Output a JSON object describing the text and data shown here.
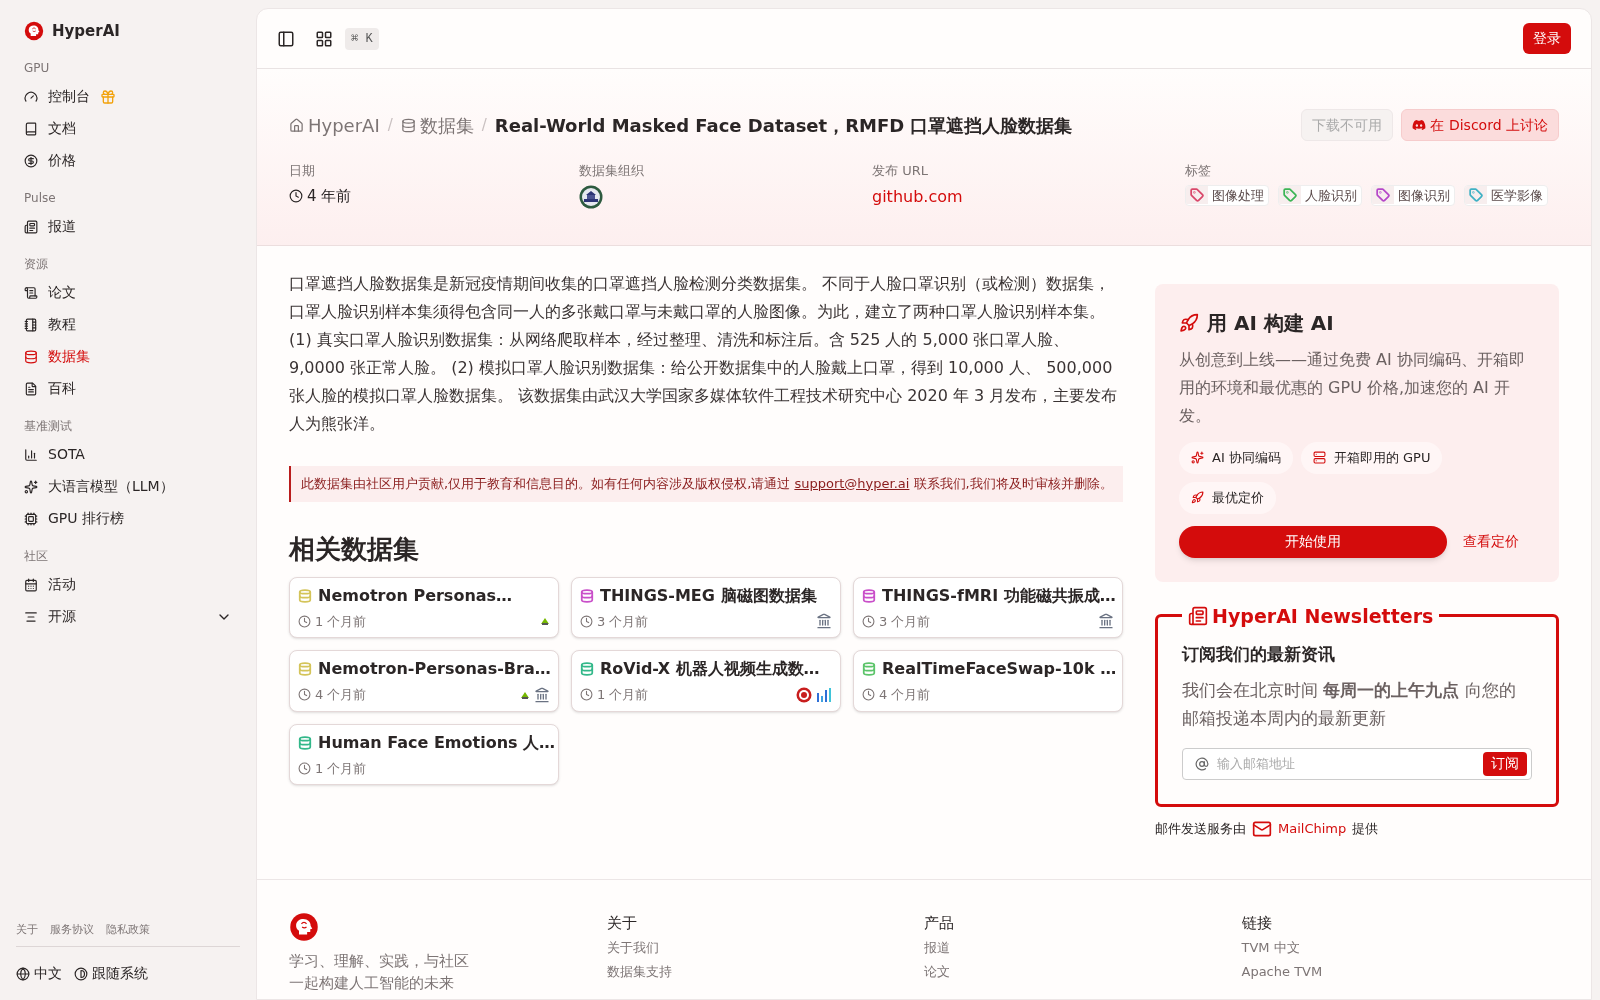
{
  "brand": {
    "name": "HyperAI"
  },
  "sidebar": {
    "groups": [
      {
        "label": "GPU",
        "items": [
          {
            "label": "控制台",
            "selected": false,
            "gift": true
          },
          {
            "label": "文档",
            "selected": false
          },
          {
            "label": "价格",
            "selected": false
          }
        ]
      },
      {
        "label": "Pulse",
        "items": [
          {
            "label": "报道",
            "selected": false
          }
        ]
      },
      {
        "label": "资源",
        "items": [
          {
            "label": "论文",
            "selected": false
          },
          {
            "label": "教程",
            "selected": false
          },
          {
            "label": "数据集",
            "selected": true
          },
          {
            "label": "百科",
            "selected": false
          }
        ]
      },
      {
        "label": "基准测试",
        "items": [
          {
            "label": "SOTA",
            "selected": false
          },
          {
            "label": "大语言模型（LLM）",
            "selected": false
          },
          {
            "label": "GPU 排行榜",
            "selected": false
          }
        ]
      },
      {
        "label": "社区",
        "items": [
          {
            "label": "活动",
            "selected": false
          },
          {
            "label": "开源",
            "selected": false,
            "expandable": true
          }
        ]
      }
    ],
    "footer_links": [
      "关于",
      "服务协议",
      "隐私政策"
    ],
    "language": "中文",
    "theme": "跟随系统"
  },
  "topbar": {
    "shortcut": "⌘ K",
    "login": "登录"
  },
  "breadcrumb": [
    {
      "kind": "link",
      "label": "HyperAI"
    },
    {
      "kind": "link",
      "separator": "/",
      "label": "数据集"
    },
    {
      "kind": "current",
      "separator": "/",
      "label": "Real-World Masked Face Dataset，RMFD 口罩遮挡人脸数据集"
    }
  ],
  "actions": {
    "download": {
      "label": "下载不可用",
      "disabled": true
    },
    "discord": "在 Discord 上讨论"
  },
  "meta": {
    "date_label": "日期",
    "date": "4 年前",
    "org_label": "数据集组织",
    "url_label": "发布 URL",
    "url": "github.com",
    "tags_label": "标签",
    "tags": [
      {
        "label": "图像处理",
        "color": "#d9486b"
      },
      {
        "label": "人脸识别",
        "color": "#3cb556"
      },
      {
        "label": "图像识别",
        "color": "#b548c9"
      },
      {
        "label": "医学影像",
        "color": "#3fb1c4"
      }
    ]
  },
  "description": "口罩遮挡人脸数据集是新冠疫情期间收集的口罩遮挡人脸检测分类数据集。 不同于人脸口罩识别（或检测）数据集，口罩人脸识别样本集须得包含同一人的多张戴口罩与未戴口罩的人脸图像。为此，建立了两种口罩人脸识别样本集。 (1) 真实口罩人脸识别数据集：从网络爬取样本，经过整理、清洗和标注后。含 525 人的 5,000 张口罩人脸、 9,0000 张正常人脸。 (2) 模拟口罩人脸识别数据集：给公开数据集中的人脸戴上口罩，得到 10,000 人、 500,000 张人脸的模拟口罩人脸数据集。 该数据集由武汉大学国家多媒体软件工程技术研究中心 2020 年 3 月发布，主要发布人为熊张洋。",
  "notice": {
    "before": "此数据集由社区用户贡献,仅用于教育和信息目的。如有任何内容涉及版权侵权,请通过 ",
    "link": "support@hyper.ai",
    "after": " 联系我们,我们将及时审核并删除。"
  },
  "related": {
    "title": "相关数据集",
    "cards": [
      {
        "title": "Nemotron Personas…",
        "time": "1 个月前",
        "color": "#d4c45a",
        "badges": [
          {
            "kind": "leaf"
          }
        ]
      },
      {
        "title": "THINGS-MEG 脑磁图数据集",
        "time": "3 个月前",
        "color": "#c94fc9",
        "badges": [
          {
            "kind": "bank"
          }
        ]
      },
      {
        "title": "THINGS-fMRI 功能磁共振成…",
        "time": "3 个月前",
        "color": "#c94fc9",
        "badges": [
          {
            "kind": "bank"
          }
        ]
      },
      {
        "title": "Nemotron-Personas-Bra…",
        "time": "4 个月前",
        "color": "#d4c45a",
        "badges": [
          {
            "kind": "leaf"
          },
          {
            "kind": "bank"
          }
        ]
      },
      {
        "title": "RoVid-X 机器人视频生成数…",
        "time": "1 个月前",
        "color": "#33b88a",
        "badges": [
          {
            "kind": "seal"
          },
          {
            "kind": "bars"
          }
        ]
      },
      {
        "title": "RealTimeFaceSwap-10k …",
        "time": "4 个月前",
        "color": "#5cc46a"
      },
      {
        "title": "Human Face Emotions 人…",
        "time": "1 个月前",
        "color": "#33b88a"
      }
    ]
  },
  "promo": {
    "title": "用 AI 构建 AI",
    "text": "从创意到上线——通过免费 AI 协同编码、开箱即用的环境和最优惠的 GPU 价格,加速您的 AI 开发。",
    "features": [
      {
        "label": "AI 协同编码"
      },
      {
        "label": "开箱即用的 GPU"
      },
      {
        "label": "最优定价"
      }
    ],
    "start": "开始使用",
    "pricing": "查看定价"
  },
  "newsletter": {
    "title": "HyperAI Newsletters",
    "heading": "订阅我们的最新资讯",
    "text": "我们会在北京时间 **每周一的上午九点** 向您的邮箱投递本周内的最新更新",
    "placeholder": "输入邮箱地址",
    "subscribe": "订阅",
    "provider_before": "邮件发送服务由",
    "provider": "MailChimp",
    "provider_after": "提供"
  },
  "footer": {
    "tagline": [
      "学习、理解、实践，与社区",
      "一起构建人工智能的未来"
    ],
    "columns": [
      {
        "heading": "关于",
        "links": [
          "关于我们",
          "数据集支持"
        ]
      },
      {
        "heading": "产品",
        "links": [
          "报道",
          "论文"
        ]
      },
      {
        "heading": "链接",
        "links": [
          "TVM 中文",
          "Apache TVM"
        ]
      }
    ]
  }
}
